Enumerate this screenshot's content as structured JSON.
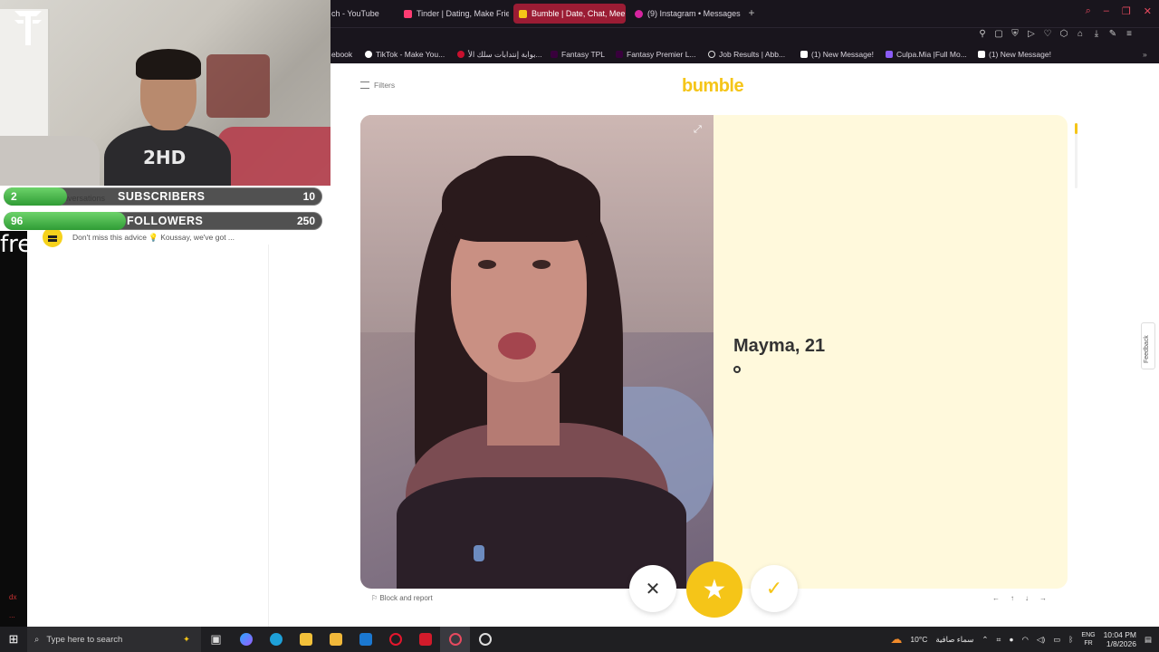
{
  "browser": {
    "tabs": [
      {
        "label": "ch - YouTube",
        "color": "#ff0033",
        "active": false
      },
      {
        "label": "Tinder | Dating, Make Frie",
        "color": "#fe3c72",
        "active": false
      },
      {
        "label": "Bumble | Date, Chat, Mee",
        "color": "#f5c518",
        "active": true
      },
      {
        "label": "(9) Instagram • Messages",
        "color": "#d6249f",
        "active": false
      }
    ],
    "bookmarks": [
      {
        "label": "ebook",
        "color": "#1877f2"
      },
      {
        "label": "TikTok - Make You...",
        "color": "#ffffff"
      },
      {
        "label": "بوابة إنتدابات سلك الأ...",
        "color": "#c8102e"
      },
      {
        "label": "Fantasy TPL",
        "color": "#38003c"
      },
      {
        "label": "Fantasy Premier L...",
        "color": "#38003c"
      },
      {
        "label": "Job Results | Abb...",
        "color": "#ffffff"
      },
      {
        "label": "(1) New Message!",
        "color": "#ffffff"
      },
      {
        "label": "Culpa.Mia |Full Mo...",
        "color": "#8b5cf6"
      },
      {
        "label": "(1) New Message!",
        "color": "#ffffff"
      }
    ]
  },
  "overlay": {
    "hoodie_text": "2HD",
    "subscribers": {
      "current": "2",
      "label": "SUBSCRIBERS",
      "goal": "10",
      "progress": 0.2
    },
    "followers": {
      "current": "96",
      "label": "FOLLOWERS",
      "goal": "250",
      "progress": 0.384
    }
  },
  "sidebar": {
    "conversations_label": "nversations",
    "left_text": "fre",
    "chat_preview": "Don't miss this advice 💡 Koussay, we've got ...",
    "dx_label": "dx",
    "dots_label": "..."
  },
  "app": {
    "brand": "bumble",
    "filters_label": "Filters",
    "profile": {
      "name": "Mayma, 21"
    },
    "block_report_label": "Block and report",
    "feedback_label": "Feedback",
    "nav_keys": [
      "←",
      "↑",
      "↓",
      "→"
    ],
    "buttons": {
      "pass": "✕",
      "superswipe": "★",
      "like": "✓"
    },
    "accent": "#f5c518",
    "card_bg": "#fff9dc"
  },
  "taskbar": {
    "search_placeholder": "Type here to search",
    "weather": "10°C",
    "weather_text": "سماء صافية",
    "lang_top": "ENG",
    "lang_bottom": "FR",
    "time": "10:04 PM",
    "date": "1/8/2026"
  }
}
